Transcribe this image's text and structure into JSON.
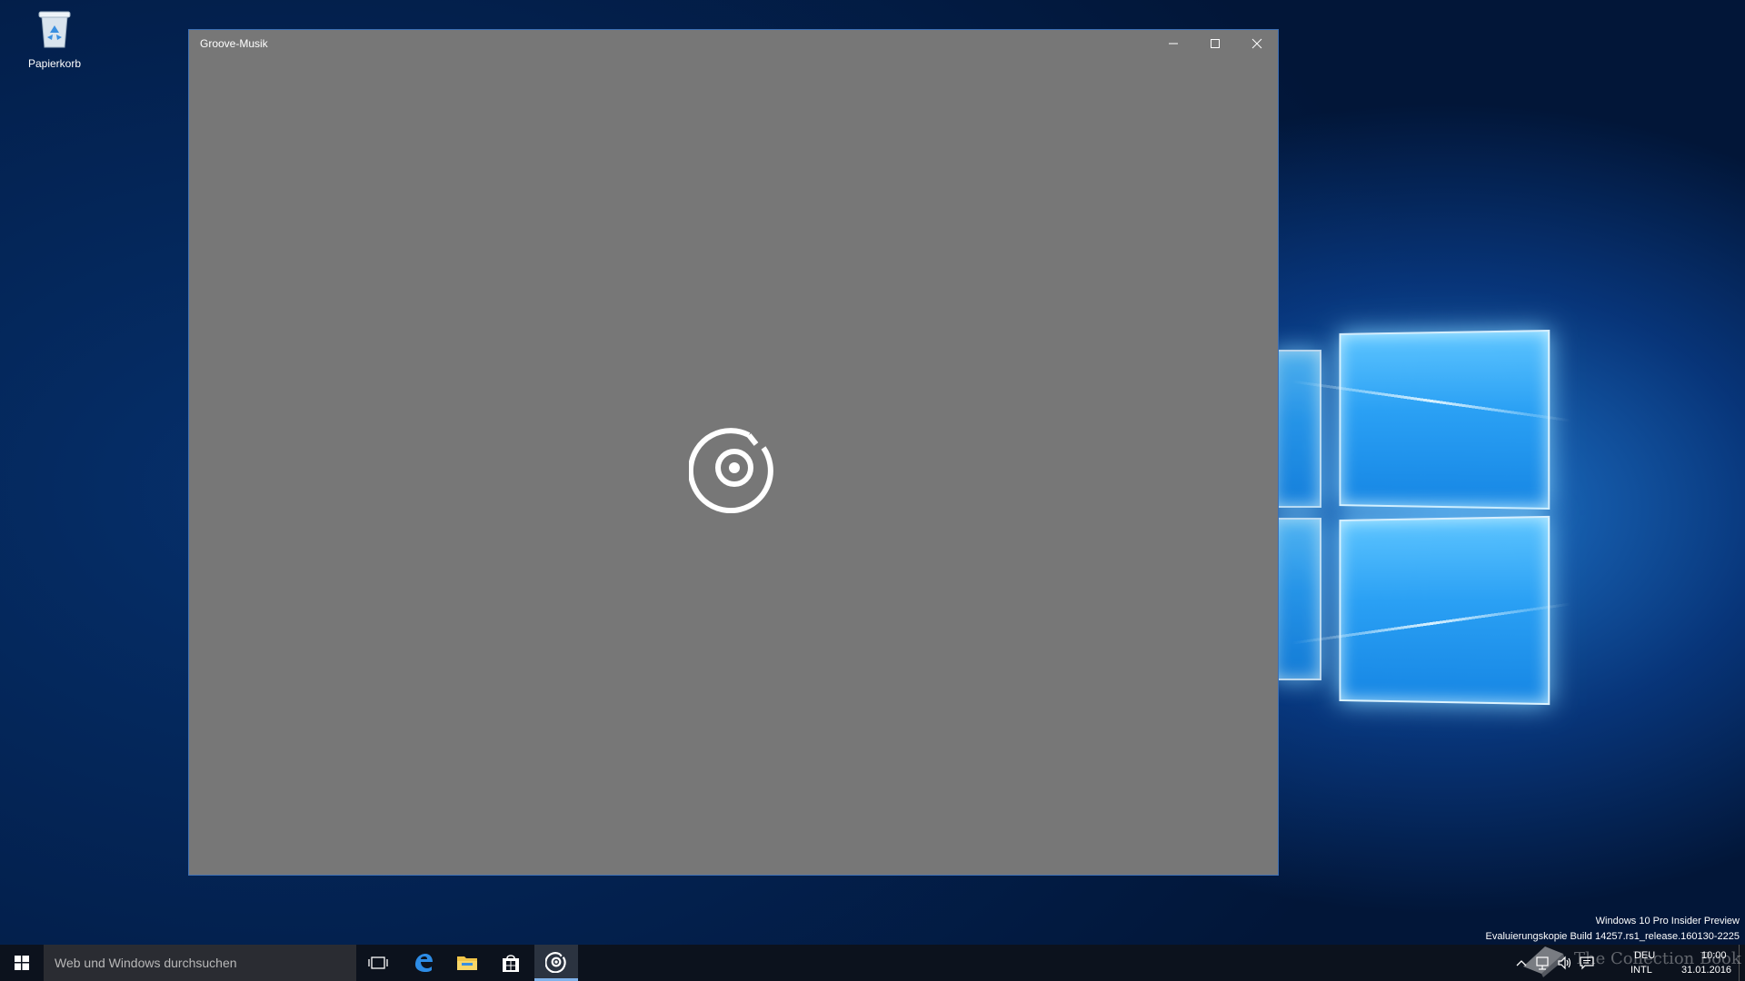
{
  "desktop": {
    "recycle_bin_label": "Papierkorb"
  },
  "window": {
    "title": "Groove-Musik",
    "minimize_icon": "minimize-icon",
    "maximize_icon": "maximize-icon",
    "close_icon": "close-icon",
    "background_color": "#777777"
  },
  "watermark": {
    "line1": "Windows 10 Pro Insider Preview",
    "line2": "Evaluierungskopie Build 14257.rs1_release.160130-2225"
  },
  "taskbar": {
    "search_placeholder": "Web und Windows durchsuchen",
    "lang_top": "DEU",
    "lang_bottom": "INTL",
    "time": "10:00",
    "date": "31.01.2016",
    "branding_text": "The Collection Book"
  },
  "colors": {
    "accent": "#1e90ff",
    "taskbar": "#0c121d"
  }
}
